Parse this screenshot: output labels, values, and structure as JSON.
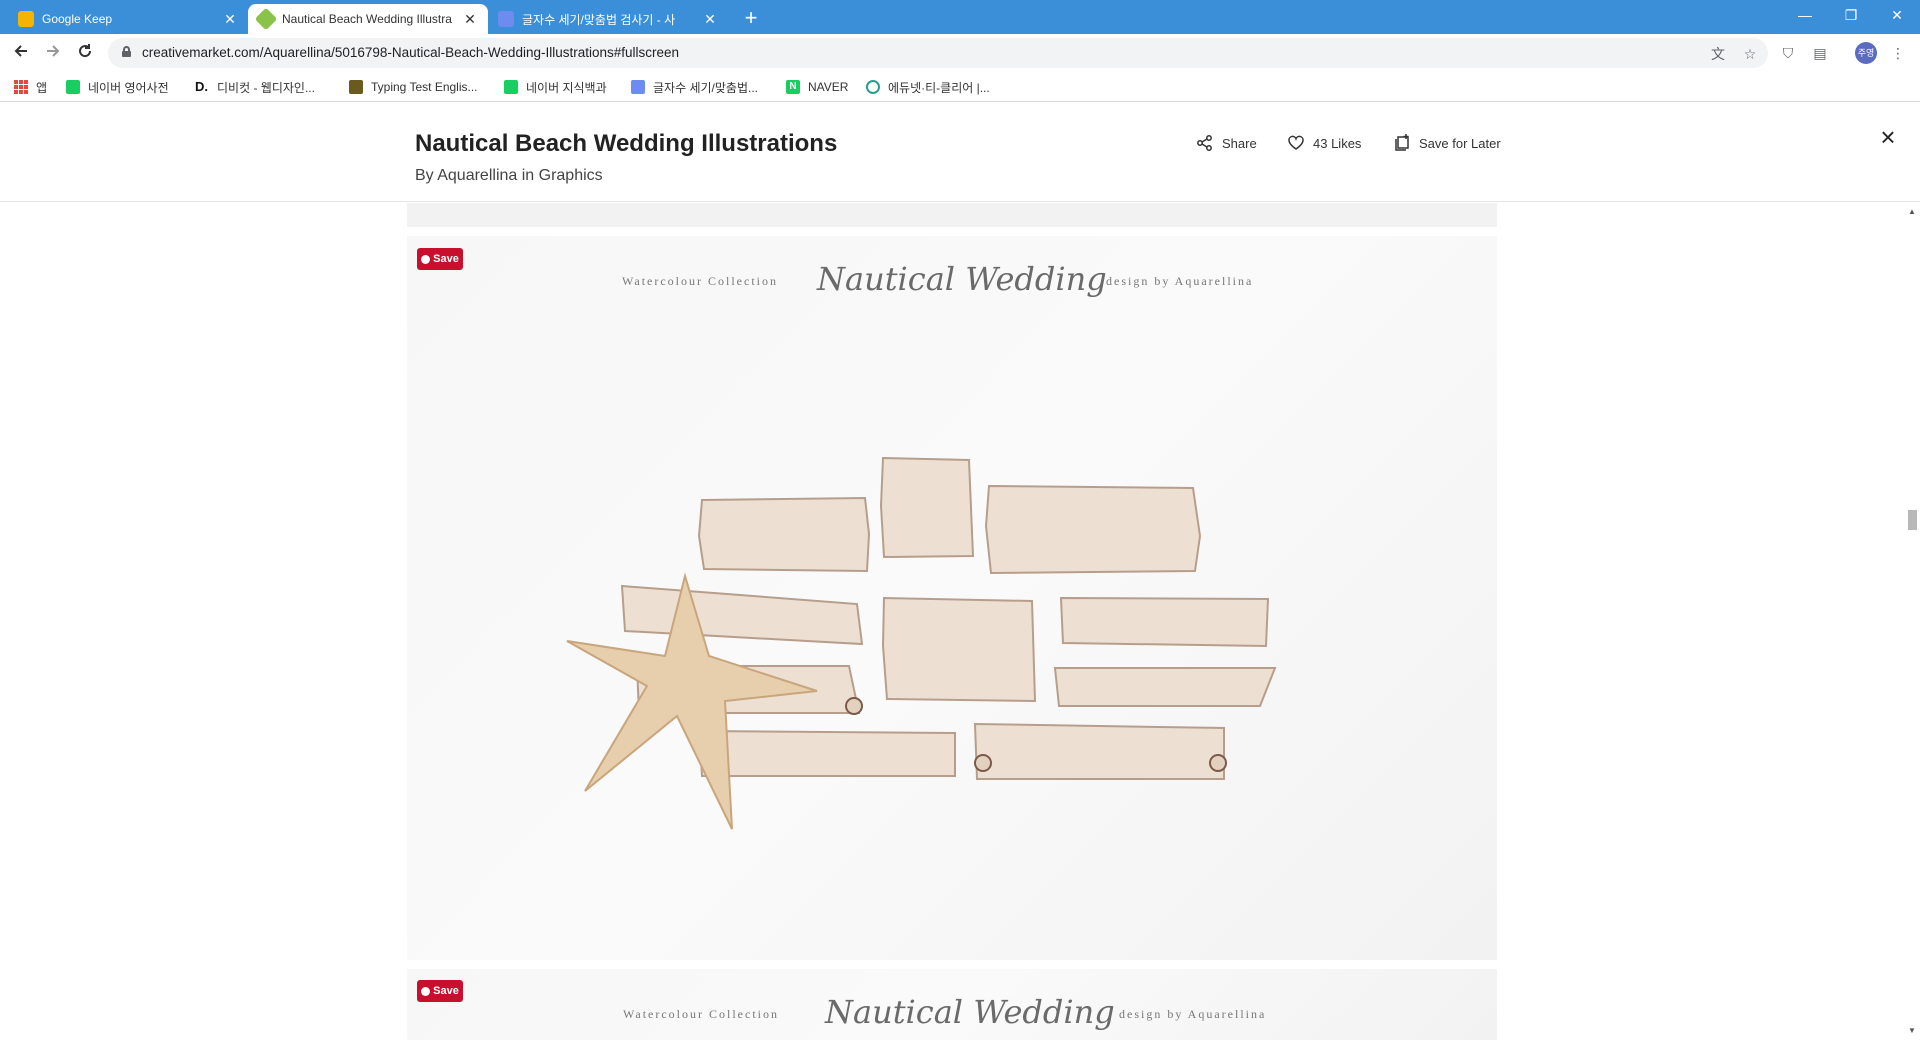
{
  "browser": {
    "tabs": [
      {
        "title": "Google Keep",
        "favicon_color": "#f4b400",
        "active": false
      },
      {
        "title": "Nautical Beach Wedding Illustra",
        "favicon_color": "#8bc34a",
        "active": true
      },
      {
        "title": "글자수 세기/맞춤법 검사기 - 사",
        "favicon_color": "#6d8cf0",
        "active": false
      }
    ],
    "new_tab_glyph": "+",
    "window_controls": [
      "—",
      "❐",
      "✕"
    ],
    "url": "creativemarket.com/Aquarellina/5016798-Nautical-Beach-Wedding-Illustrations#fullscreen",
    "avatar_text": "주영",
    "bookmarks": [
      {
        "label": "앱",
        "icon": "apps-grid-icon",
        "color": "#e8453c"
      },
      {
        "label": "네이버 영어사전",
        "icon": "naver-dict-icon",
        "color": "#19ce60"
      },
      {
        "label": "디비컷 - 웹디자인...",
        "icon": "dbcut-icon",
        "color": "#111111"
      },
      {
        "label": "Typing Test Englis...",
        "icon": "typing-test-icon",
        "color": "#6b5a1e"
      },
      {
        "label": "네이버 지식백과",
        "icon": "naver-knowledge-icon",
        "color": "#19ce60"
      },
      {
        "label": "글자수 세기/맞춤법...",
        "icon": "char-count-icon",
        "color": "#6d8cf0"
      },
      {
        "label": "NAVER",
        "icon": "naver-icon",
        "color": "#19ce60"
      },
      {
        "label": "에듀넷·티-클리어 |...",
        "icon": "edunet-icon",
        "color": "#2a9d8f"
      }
    ]
  },
  "page": {
    "title": "Nautical Beach Wedding Illustrations",
    "byline": "By Aquarellina in Graphics",
    "actions": {
      "share": "Share",
      "likes": "43 Likes",
      "save_later": "Save for Later"
    },
    "close_glyph": "×"
  },
  "previews": [
    {
      "pin_label": "Save",
      "left_text": "Watercolour Collection",
      "script_title": "Nautical Wedding",
      "right_text": "design by Aquarellina"
    },
    {
      "pin_label": "Save",
      "left_text": "Watercolour Collection",
      "script_title": "Nautical Wedding",
      "right_text": "design by Aquarellina"
    }
  ],
  "colors": {
    "tabbar": "#3b8fd9",
    "pinterest_red": "#c8102e",
    "parchment": "#ede0d2",
    "starfish": "#e7cfae"
  }
}
